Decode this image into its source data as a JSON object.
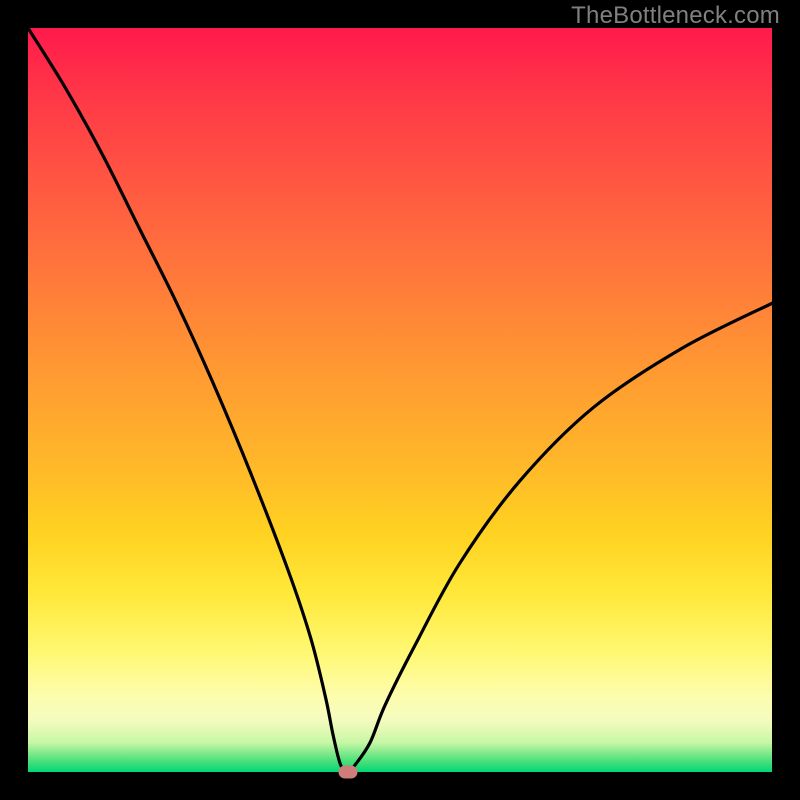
{
  "watermark": {
    "text": "TheBottleneck.com"
  },
  "colors": {
    "curve_stroke": "#000000",
    "marker_fill": "#cf7d7a",
    "frame_bg": "#000000"
  },
  "chart_data": {
    "type": "line",
    "title": "",
    "xlabel": "",
    "ylabel": "",
    "xlim": [
      0,
      100
    ],
    "ylim": [
      0,
      100
    ],
    "annotations": [
      "TheBottleneck.com"
    ],
    "series": [
      {
        "name": "bottleneck-curve",
        "x": [
          0,
          5,
          10,
          15,
          20,
          25,
          30,
          35,
          38,
          40,
          41,
          42,
          43,
          44,
          46,
          48,
          52,
          58,
          66,
          76,
          88,
          100
        ],
        "y": [
          100,
          92,
          83,
          73,
          63,
          52,
          40,
          27,
          18,
          10,
          5,
          1,
          0,
          1,
          4,
          9,
          17,
          28,
          39,
          49,
          57,
          63
        ]
      }
    ],
    "marker": {
      "x": 43,
      "y": 0
    },
    "gradient_stops": [
      {
        "pct": 0,
        "hex": "#ff1a4c"
      },
      {
        "pct": 10,
        "hex": "#ff3a47"
      },
      {
        "pct": 22,
        "hex": "#ff5a41"
      },
      {
        "pct": 34,
        "hex": "#ff7a3a"
      },
      {
        "pct": 46,
        "hex": "#ff9932"
      },
      {
        "pct": 58,
        "hex": "#ffb62a"
      },
      {
        "pct": 68,
        "hex": "#ffd221"
      },
      {
        "pct": 76,
        "hex": "#ffe83a"
      },
      {
        "pct": 84,
        "hex": "#fff873"
      },
      {
        "pct": 90,
        "hex": "#fdfdaf"
      },
      {
        "pct": 93,
        "hex": "#f4fbbf"
      },
      {
        "pct": 96,
        "hex": "#c9f7a6"
      },
      {
        "pct": 98.5,
        "hex": "#4de07a"
      },
      {
        "pct": 100,
        "hex": "#00d777"
      }
    ]
  }
}
